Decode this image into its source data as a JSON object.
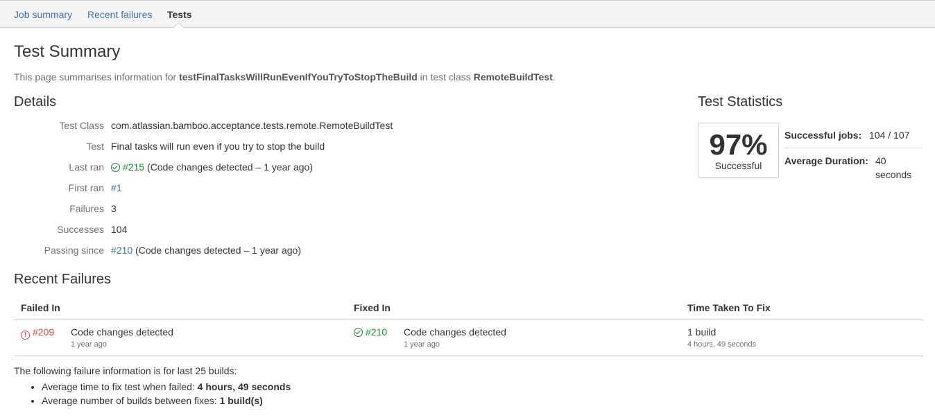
{
  "tabs": [
    {
      "label": "Job summary",
      "active": false
    },
    {
      "label": "Recent failures",
      "active": false
    },
    {
      "label": "Tests",
      "active": true
    }
  ],
  "page_title": "Test Summary",
  "intro": {
    "prefix": "This page summarises information for ",
    "test_name": "testFinalTasksWillRunEvenIfYouTryToStopTheBuild",
    "middle": " in test class ",
    "class_name": "RemoteBuildTest",
    "suffix": "."
  },
  "details": {
    "heading": "Details",
    "test_class_label": "Test Class",
    "test_class_value": "com.atlassian.bamboo.acceptance.tests.remote.RemoteBuildTest",
    "test_label": "Test",
    "test_value": "Final tasks will run even if you try to stop the build",
    "last_ran_label": "Last ran",
    "last_ran_link": "#215",
    "last_ran_note": " (Code changes detected – 1 year ago)",
    "first_ran_label": "First ran",
    "first_ran_link": "#1",
    "failures_label": "Failures",
    "failures_value": "3",
    "successes_label": "Successes",
    "successes_value": "104",
    "passing_since_label": "Passing since",
    "passing_since_link": "#210",
    "passing_since_note": " (Code changes detected – 1 year ago)"
  },
  "statistics": {
    "heading": "Test Statistics",
    "percent": "97%",
    "percent_label": "Successful",
    "successful_jobs_label": "Successful jobs:",
    "successful_jobs_value": "104 / 107",
    "avg_duration_label": "Average Duration:",
    "avg_duration_value_line1": "40",
    "avg_duration_value_line2": "seconds"
  },
  "recent_failures": {
    "heading": "Recent Failures",
    "columns": [
      "Failed In",
      "Fixed In",
      "Time Taken To Fix"
    ],
    "rows": [
      {
        "failed_link": "#209",
        "failed_reason": "Code changes detected",
        "failed_time": "1 year ago",
        "fixed_link": "#210",
        "fixed_reason": "Code changes detected",
        "fixed_time": "1 year ago",
        "fix_builds": "1 build",
        "fix_duration": "4 hours, 49 seconds"
      }
    ]
  },
  "summary": {
    "note": "The following failure information is for last 25 builds:",
    "avg_time_label": "Average time to fix test when failed: ",
    "avg_time_value": "4 hours, 49 seconds",
    "avg_builds_label": "Average number of builds between fixes: ",
    "avg_builds_value": "1 build(s)"
  },
  "colors": {
    "link": "#3572b0",
    "success": "#14892c",
    "failure": "#d04437"
  }
}
